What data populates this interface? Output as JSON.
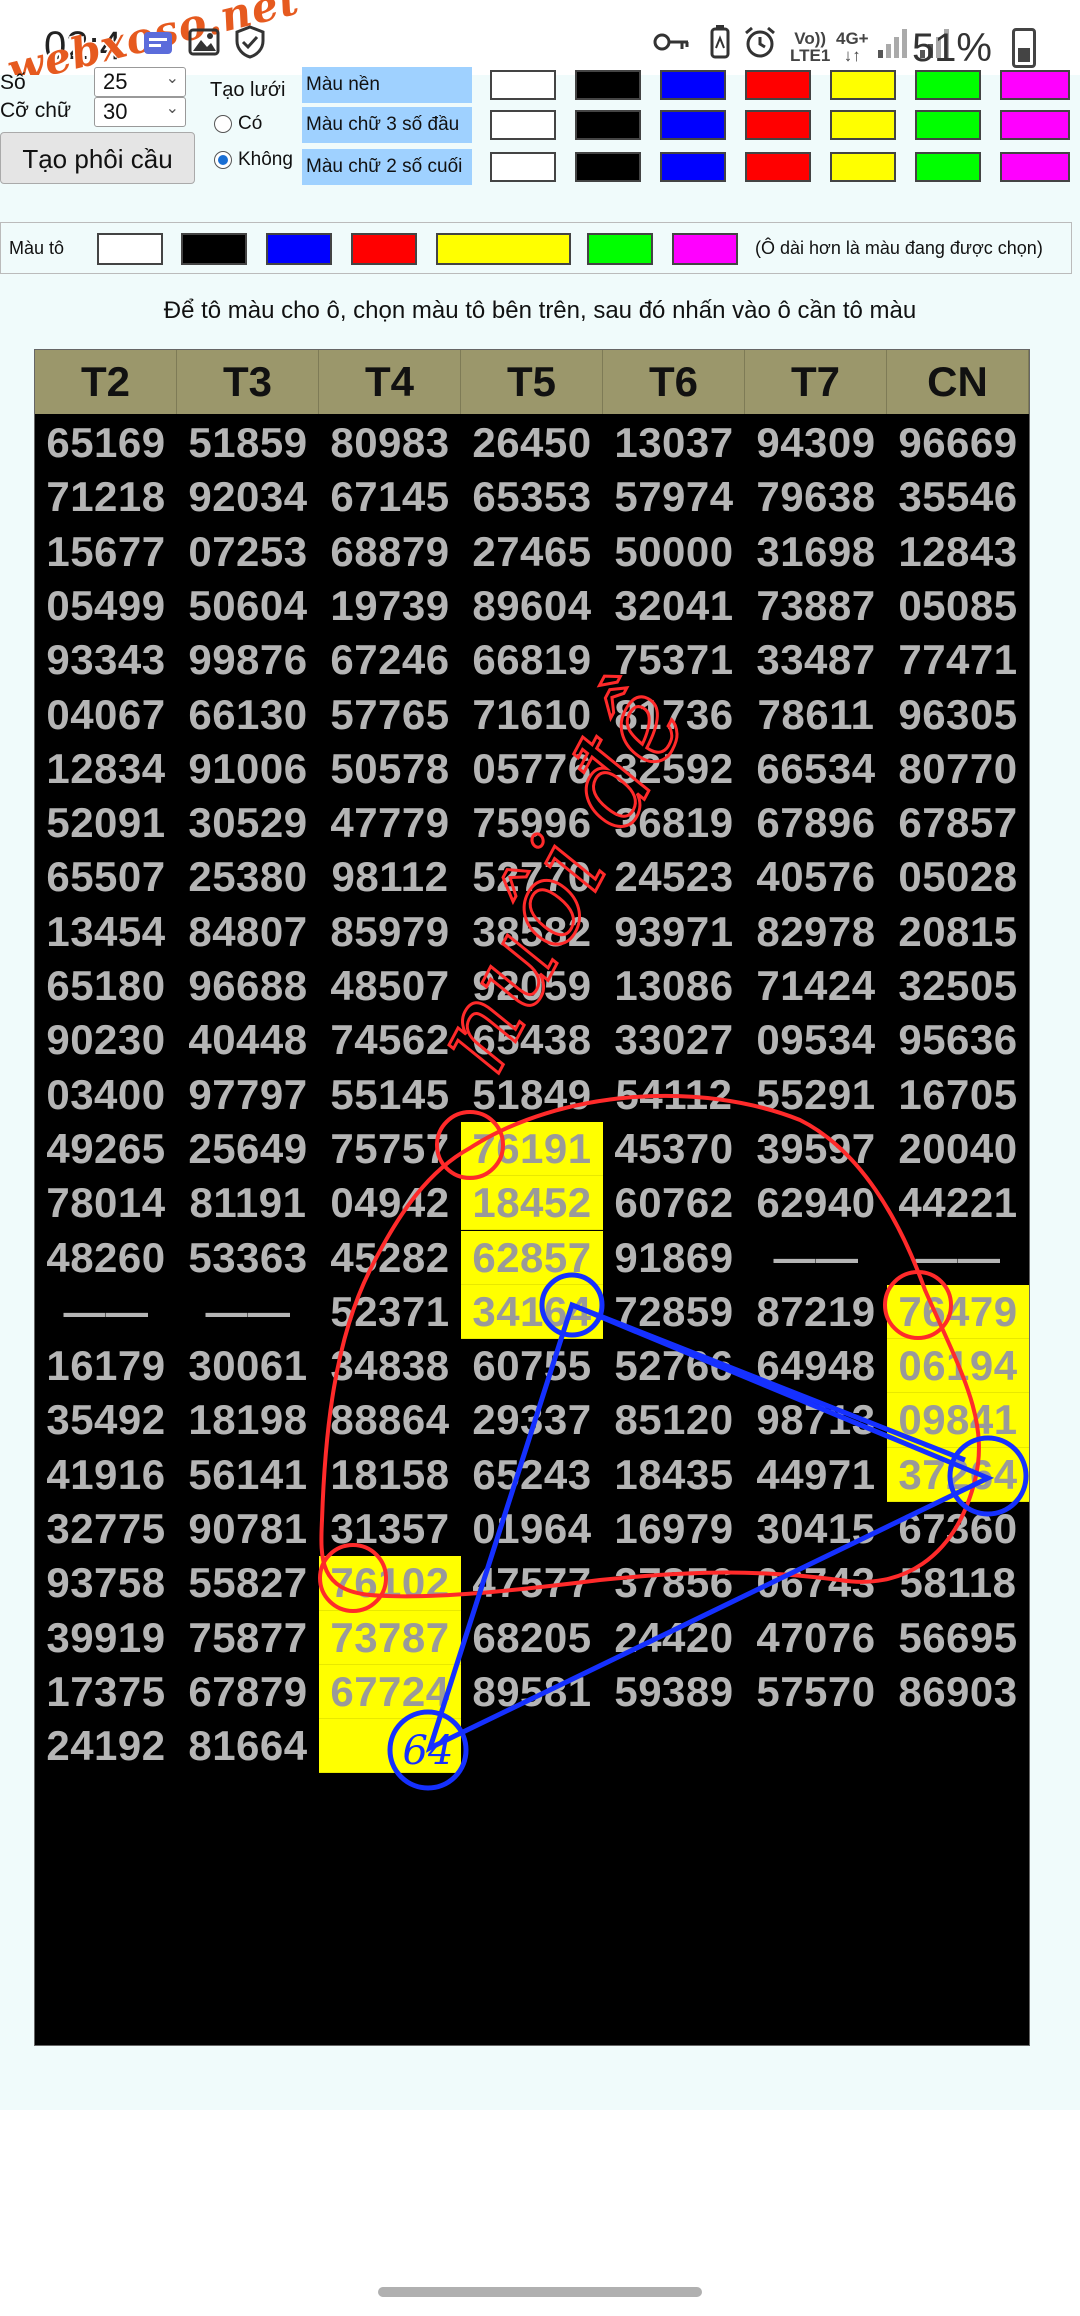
{
  "status_bar": {
    "time": "02:4",
    "battery": "51%",
    "lte_top": "Vo))",
    "lte_bottom": "LTE1",
    "net_type_top": "4G+",
    "net_type_bottom": "↓↑",
    "watermark": "webxoso.net"
  },
  "controls": {
    "so_label": "Số",
    "so_value": "25",
    "co_chu_label": "Cỡ chữ",
    "co_chu_value": "30",
    "tao_phoi_button": "Tạo phôi cầu",
    "tao_luoi_label": "Tạo lưới",
    "radio_co": "Có",
    "radio_khong": "Không",
    "radio_selected": "Không",
    "color_rows": [
      {
        "label": "Màu nền"
      },
      {
        "label": "Màu chữ 3 số đầu"
      },
      {
        "label": "Màu chữ 2 số cuối"
      }
    ],
    "swatch_colors": [
      "#ffffff",
      "#000000",
      "#0000ff",
      "#ff0000",
      "#ffff00",
      "#00ff00",
      "#ff00ff"
    ]
  },
  "paint": {
    "label": "Màu tô",
    "note": "(Ô dài hơn là màu đang được chọn)",
    "swatch_colors": [
      "#ffffff",
      "#000000",
      "#0000ff",
      "#ff0000",
      "#ffff00",
      "#00ff00",
      "#ff00ff"
    ],
    "selected_color": "#ffff00"
  },
  "instruction": "Để tô màu cho ô, chọn màu tô bên trên, sau đó nhấn vào ô cần tô màu",
  "table": {
    "headers": [
      "T2",
      "T3",
      "T4",
      "T5",
      "T6",
      "T7",
      "CN"
    ],
    "rows": [
      [
        "65169",
        "51859",
        "80983",
        "26450",
        "13037",
        "94309",
        "96669"
      ],
      [
        "71218",
        "92034",
        "67145",
        "65353",
        "57974",
        "79638",
        "35546"
      ],
      [
        "15677",
        "07253",
        "68879",
        "27465",
        "50000",
        "31698",
        "12843"
      ],
      [
        "05499",
        "50604",
        "19739",
        "89604",
        "32041",
        "73887",
        "05085"
      ],
      [
        "93343",
        "99876",
        "67246",
        "66819",
        "75371",
        "33487",
        "77471"
      ],
      [
        "04067",
        "66130",
        "57765",
        "71610",
        "81736",
        "78611",
        "96305"
      ],
      [
        "12834",
        "91006",
        "50578",
        "05776",
        "32592",
        "66534",
        "80770"
      ],
      [
        "52091",
        "30529",
        "47779",
        "75996",
        "36819",
        "67896",
        "67857"
      ],
      [
        "65507",
        "25380",
        "98112",
        "52770",
        "24523",
        "40576",
        "05028"
      ],
      [
        "13454",
        "84807",
        "85979",
        "38582",
        "93971",
        "82978",
        "20815"
      ],
      [
        "65180",
        "96688",
        "48507",
        "92059",
        "13086",
        "71424",
        "32505"
      ],
      [
        "90230",
        "40448",
        "74562",
        "65438",
        "33027",
        "09534",
        "95636"
      ],
      [
        "03400",
        "97797",
        "55145",
        "51849",
        "54112",
        "55291",
        "16705"
      ],
      [
        "49265",
        "25649",
        "75757",
        "76191",
        "45370",
        "39597",
        "20040"
      ],
      [
        "78014",
        "81191",
        "04942",
        "18452",
        "60762",
        "62940",
        "44221"
      ],
      [
        "48260",
        "53363",
        "45282",
        "62857",
        "91869",
        "——",
        "——"
      ],
      [
        "——",
        "——",
        "52371",
        "34164",
        "72859",
        "87219",
        "76479"
      ],
      [
        "16179",
        "30061",
        "34838",
        "60755",
        "52766",
        "64948",
        "06194"
      ],
      [
        "35492",
        "18198",
        "88864",
        "29337",
        "85120",
        "98713",
        "09841"
      ],
      [
        "41916",
        "56141",
        "18158",
        "65243",
        "18435",
        "44971",
        "37264"
      ],
      [
        "32775",
        "90781",
        "31357",
        "01964",
        "16979",
        "30415",
        "67360"
      ],
      [
        "93758",
        "55827",
        "76102",
        "47577",
        "37856",
        "06743",
        "58118"
      ],
      [
        "39919",
        "75877",
        "73787",
        "68205",
        "24420",
        "47076",
        "56695"
      ],
      [
        "17375",
        "67879",
        "67724",
        "89581",
        "59389",
        "57570",
        "86903"
      ],
      [
        "24192",
        "81664",
        "",
        "",
        "",
        "",
        ""
      ]
    ],
    "highlighted": [
      [
        13,
        3
      ],
      [
        14,
        3
      ],
      [
        15,
        3
      ],
      [
        16,
        3
      ],
      [
        16,
        6
      ],
      [
        17,
        6
      ],
      [
        18,
        6
      ],
      [
        19,
        6
      ],
      [
        21,
        2
      ],
      [
        22,
        2
      ],
      [
        23,
        2
      ],
      [
        24,
        2
      ]
    ],
    "highlight_color": "#ffff00"
  },
  "annotations": {
    "handwriting": "nuôi đề",
    "circled_number": "64"
  }
}
